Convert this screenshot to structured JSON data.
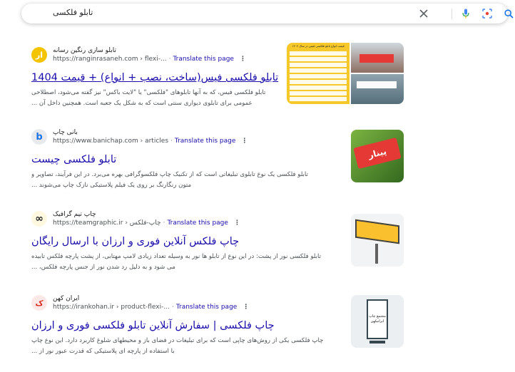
{
  "search": {
    "query": "تابلو فلکسی"
  },
  "results": [
    {
      "site_name": "تابلو سازی رنگین رسانه",
      "url": "https://ranginrasaneh.com › flexi-...",
      "translate": "Translate this page",
      "title": "تابلو فلکسی فیس(ساخت، نصب + انواع) + قیمت 1404",
      "snippet_lines": [
        "تابلو فلکسی فیس، که به آنها تابلوهای \"فلکسی\" یا \"لایت باکس\" نیز گفته می‌شود، اصطلاحی",
        "عمومی برای تابلوی دیواری سنتی است که به شکل یک جعبه است. همچنین داخل آن ..."
      ],
      "favicon_text": "ار",
      "favicon_color": "#f5c400",
      "thumb_title": "قیمت انواع تابلو فلکسی فیس در سال ۱۴۰۴"
    },
    {
      "site_name": "بانی چاپ",
      "url": "https://www.banichap.com › articles",
      "translate": "Translate this page",
      "title": "تابلو فلکسی چیست",
      "snippet_lines": [
        "تابلو فلکسی یک نوع تابلوی تبلیغاتی است که از تکنیک چاپ فلکسوگرافی بهره می‌برد. در این فرآیند، تصاویر و",
        "متون رنگارنگ بر روی یک فیلم پلاستیکی نازک چاپ می‌شوند ..."
      ],
      "favicon_text": "b",
      "favicon_color": "#1a73e8",
      "thumb_text": "پینار"
    },
    {
      "site_name": "چاپ تیم گرافیک",
      "url": "https://teamgraphic.ir › چاپ-فلکس",
      "translate": "Translate this page",
      "title": "چاپ فلکس آنلاین فوری و ارزان با ارسال رایگان",
      "snippet_lines": [
        "تابلو فلکسی نور از پشت: در این نوع از تابلو ها نور به وسیله تعداد زیادی لامپ مهتابی، از پشت پارچه فلکس تابیده",
        "می شود و به دلیل رد شدن نور از جنس پارچه فلکس، ..."
      ],
      "favicon_text": "∞",
      "favicon_color": "#f4b400"
    },
    {
      "site_name": "ایران کهن",
      "url": "https://irankohan.ir › product-flexi-...",
      "translate": "Translate this page",
      "title": "چاپ فلکسی | سفارش آنلاین تابلو فلکسی فوری و ارزان",
      "snippet_lines": [
        "چاپ فلکسی یکی از روش‌های چاپی است که برای تبلیغات در فضای باز و محیطهای شلوغ کاربرد دارد. این نوع چاپ",
        "با استفاده از پارچه ای پلاستیکی که قدرت عبور نور از ..."
      ],
      "favicon_text": "ک",
      "favicon_color": "#d93025",
      "thumb_text": "مجتمع چاپ ایرانیکهن"
    }
  ]
}
